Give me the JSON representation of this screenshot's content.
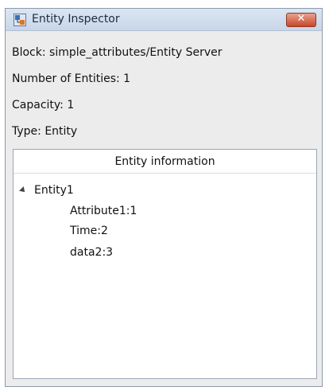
{
  "window": {
    "title": "Entity Inspector",
    "close_label": "✕"
  },
  "info": {
    "block": "Block: simple_attributes/Entity Server",
    "num_entities": "Number of Entities: 1",
    "capacity": "Capacity: 1",
    "type": "Type: Entity"
  },
  "panel": {
    "header": "Entity information",
    "tree": {
      "node_label": "Entity1",
      "expanded": true,
      "children": [
        "Attribute1:1",
        "Time:2",
        "data2:3"
      ]
    }
  }
}
